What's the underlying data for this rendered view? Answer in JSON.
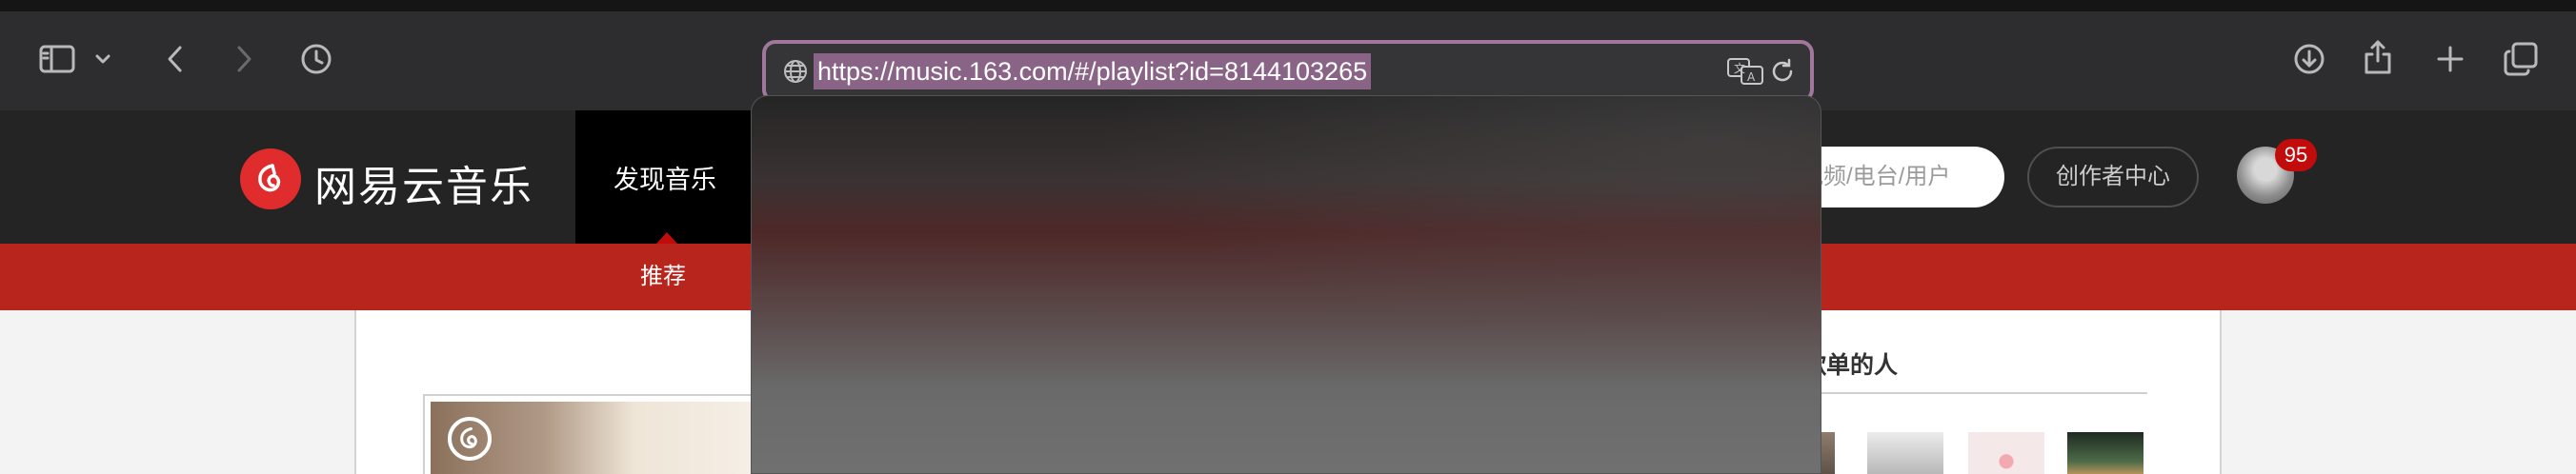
{
  "browser": {
    "url": "https://music.163.com/#/playlist?id=8144103265"
  },
  "site": {
    "brand": "网易云音乐",
    "nav_active": "发现音乐",
    "search_placeholder": "视频/电台/用户",
    "creator_center": "创作者中心",
    "notification_count": "95",
    "subnav_active": "推荐"
  },
  "sidebar": {
    "title": "这个歌单的人"
  },
  "colors": {
    "brand_red": "#c20c0c",
    "subnav_red": "#b8251c",
    "address_focus": "#a2779d"
  }
}
